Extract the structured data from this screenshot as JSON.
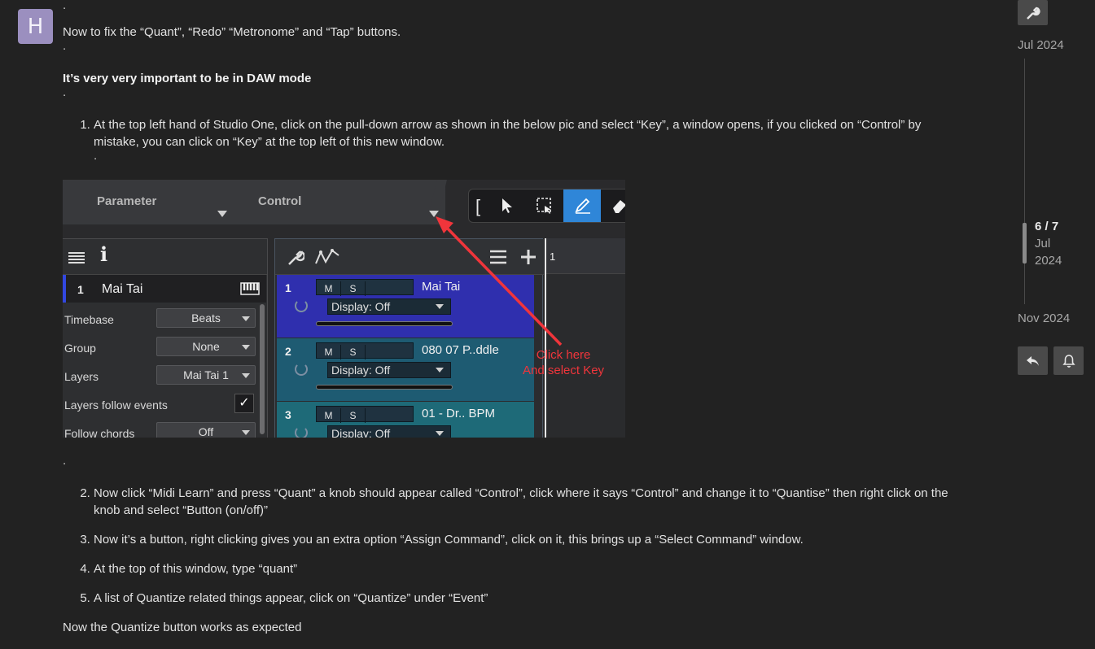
{
  "avatar": {
    "letter": "H"
  },
  "post": {
    "top_dot": ".",
    "intro": "Now to fix the “Quant”, “Redo” “Metronome” and “Tap” buttons.",
    "dot2": ".",
    "important": "It’s very very important to be in DAW mode",
    "dot3": ".",
    "step1": "At the top left hand of Studio One, click on the pull-down arrow as shown in the below pic and select “Key”, a window opens, if you clicked on “Control” by mistake, you can click on “Key” at the top left of this new window.",
    "step1_dot": ".",
    "after_image_dot": ".",
    "step2": "Now click “Midi Learn” and press “Quant” a knob should appear called “Control”, click where it says “Control” and change it to “Quantise” then right click on the knob and select “Button (on/off)”",
    "step3": "Now it’s a button, right clicking gives you an extra option “Assign Command”, click on it, this brings up a “Select Command” window.",
    "step4": "At the top of this window, type “quant”",
    "step5": "A list of Quantize related things appear, click on “Quantize” under “Event”",
    "outro": "Now the Quantize button works as expected"
  },
  "screenshot": {
    "header_labels": {
      "parameter": "Parameter",
      "control": "Control"
    },
    "inspector": {
      "track_number": "1",
      "track_name": "Mai Tai",
      "info_icon": "i",
      "rows": [
        {
          "label": "Timebase",
          "value": "Beats"
        },
        {
          "label": "Group",
          "value": "None"
        },
        {
          "label": "Layers",
          "value": "Mai Tai 1"
        },
        {
          "label": "Layers follow events",
          "value": "✓"
        },
        {
          "label": "Follow chords",
          "value": "Off"
        }
      ]
    },
    "tracks": [
      {
        "number": "1",
        "mute": "M",
        "solo": "S",
        "name": "Mai Tai",
        "display": "Display: Off",
        "color": "#2f2fae"
      },
      {
        "number": "2",
        "mute": "M",
        "solo": "S",
        "name": "080 07 P..ddle",
        "display": "Display: Off",
        "color": "#1e5b72"
      },
      {
        "number": "3",
        "mute": "M",
        "solo": "S",
        "name": "01 - Dr.. BPM",
        "display": "Display: Off",
        "color": "#1e6a78"
      }
    ],
    "ruler_label": "1",
    "callout": {
      "line1": "Click here",
      "line2": "And select Key",
      "color": "#f0353b"
    }
  },
  "rail": {
    "date_top": "Jul 2024",
    "position": "6 / 7",
    "position_month": "Jul",
    "position_year": "2024",
    "date_bottom": "Nov 2024"
  }
}
